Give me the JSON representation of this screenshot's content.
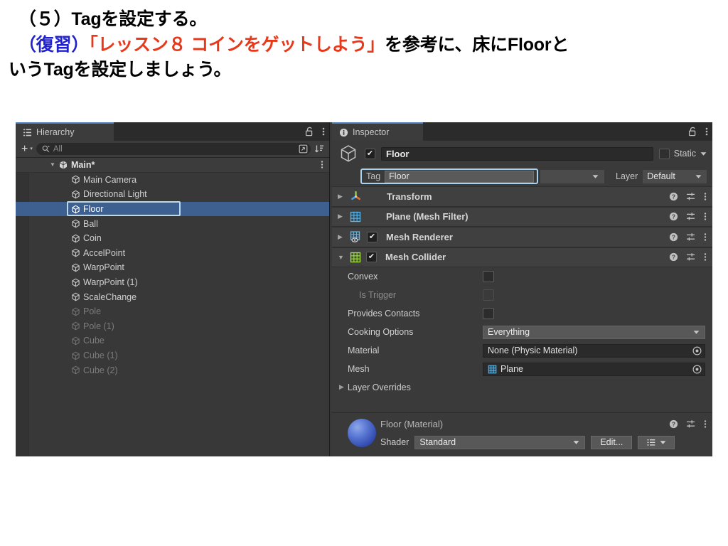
{
  "slide": {
    "line1": "（５）Tagを設定する。",
    "line2_prefix": "（復習）",
    "line2_quote": "「レッスン８ コインをゲットしよう」",
    "line2_suffix": "を参考に、床にFloorと",
    "line3": "いうTagを設定しましょう。",
    "color_blue": "#2222cc",
    "color_red": "#e8381b"
  },
  "hierarchy": {
    "tab_label": "Hierarchy",
    "tab_icon": "hierarchy-icon",
    "lock_icon": "lock-icon",
    "menu_icon": "kebab-menu-icon",
    "add_label": "+",
    "add_caret": "▾",
    "search_icon": "search-icon",
    "search_placeholder": "All",
    "search_value": "",
    "expand_icon": "open-in-new-icon",
    "sort_icon": "sort-icon",
    "scene": {
      "label": "Main*",
      "triangle": "▼",
      "icon": "unity-scene-icon",
      "menu_icon": "kebab-menu-icon"
    },
    "items": [
      {
        "label": "Main Camera",
        "icon": "gameobject-icon",
        "selected": false,
        "dim": false
      },
      {
        "label": "Directional Light",
        "icon": "gameobject-icon",
        "selected": false,
        "dim": false
      },
      {
        "label": "Floor",
        "icon": "gameobject-icon",
        "selected": true,
        "dim": false
      },
      {
        "label": "Ball",
        "icon": "gameobject-icon",
        "selected": false,
        "dim": false
      },
      {
        "label": "Coin",
        "icon": "gameobject-icon",
        "selected": false,
        "dim": false
      },
      {
        "label": "AccelPoint",
        "icon": "gameobject-icon",
        "selected": false,
        "dim": false
      },
      {
        "label": "WarpPoint",
        "icon": "gameobject-icon",
        "selected": false,
        "dim": false
      },
      {
        "label": "WarpPoint (1)",
        "icon": "gameobject-icon",
        "selected": false,
        "dim": false
      },
      {
        "label": "ScaleChange",
        "icon": "gameobject-icon",
        "selected": false,
        "dim": false
      },
      {
        "label": "Pole",
        "icon": "gameobject-icon",
        "selected": false,
        "dim": true
      },
      {
        "label": "Pole (1)",
        "icon": "gameobject-icon",
        "selected": false,
        "dim": true
      },
      {
        "label": "Cube",
        "icon": "gameobject-icon",
        "selected": false,
        "dim": true
      },
      {
        "label": "Cube (1)",
        "icon": "gameobject-icon",
        "selected": false,
        "dim": true
      },
      {
        "label": "Cube (2)",
        "icon": "gameobject-icon",
        "selected": false,
        "dim": true
      }
    ],
    "selection_color": "#3d6091",
    "highlight_outline_color": "#b9d9ef"
  },
  "inspector": {
    "tab_label": "Inspector",
    "tab_icon": "info-icon",
    "lock_icon": "lock-icon",
    "menu_icon": "kebab-menu-icon",
    "object": {
      "icon": "gameobject-cube-icon",
      "enabled_checkbox": "✔",
      "name": "Floor",
      "static_checked": false,
      "static_label": "Static",
      "static_caret": "▼"
    },
    "tag_row": {
      "tag_label": "Tag",
      "tag_value": "Floor",
      "tag_caret": "▼",
      "layer_label": "Layer",
      "layer_value": "Default",
      "layer_caret": "▼",
      "highlight_color": "#a9d2ec"
    },
    "components": [
      {
        "name": "Transform",
        "triangle": "▶",
        "icon": "transform-gizmo-icon",
        "has_checkbox": false,
        "checked": false
      },
      {
        "name": "Plane (Mesh Filter)",
        "triangle": "▶",
        "icon": "mesh-filter-icon",
        "has_checkbox": false,
        "checked": false
      },
      {
        "name": "Mesh Renderer",
        "triangle": "▶",
        "icon": "mesh-renderer-icon",
        "has_checkbox": true,
        "checked": true
      },
      {
        "name": "Mesh Collider",
        "triangle": "▼",
        "icon": "mesh-collider-icon",
        "has_checkbox": true,
        "checked": true
      }
    ],
    "component_icons": {
      "help": "help-icon",
      "preset": "preset-icon",
      "menu": "kebab-menu-icon"
    },
    "mesh_collider_props": [
      {
        "label": "Convex",
        "type": "checkbox",
        "value": false,
        "disabled": false
      },
      {
        "label": "Is Trigger",
        "type": "checkbox",
        "value": false,
        "disabled": true
      },
      {
        "label": "Provides Contacts",
        "type": "checkbox",
        "value": false,
        "disabled": false
      },
      {
        "label": "Cooking Options",
        "type": "dropdown",
        "value": "Everything"
      },
      {
        "label": "Material",
        "type": "objectfield",
        "value": "None (Physic Material)",
        "icon": ""
      },
      {
        "label": "Mesh",
        "type": "objectfield",
        "value": "Plane",
        "icon": "mesh-grid-icon"
      }
    ],
    "layer_overrides": {
      "label": "Layer Overrides",
      "triangle": "▶"
    },
    "material": {
      "title": "Floor (Material)",
      "preview_icon": "material-sphere-preview",
      "shader_label": "Shader",
      "shader_value": "Standard",
      "shader_caret": "▼",
      "edit_label": "Edit...",
      "list_icon": "list-icon",
      "list_caret": "▼",
      "help_icon": "help-icon",
      "preset_icon": "preset-icon",
      "menu_icon": "kebab-menu-icon"
    }
  }
}
